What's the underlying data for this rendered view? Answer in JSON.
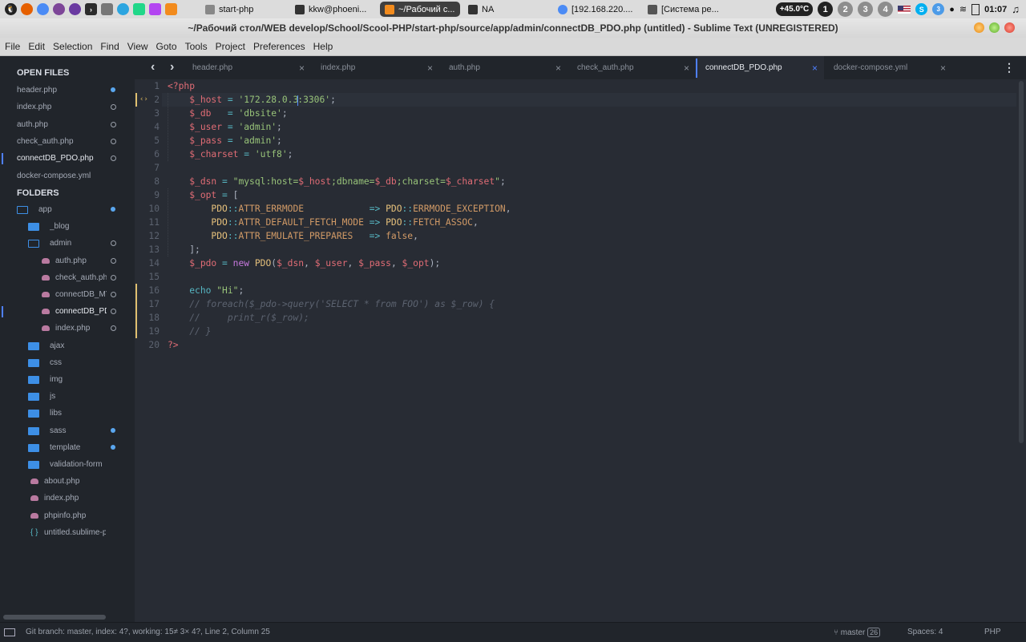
{
  "system_panel": {
    "taskbar": [
      {
        "label": "start-php",
        "active": false
      },
      {
        "label": "kkw@phoeni...",
        "active": false
      },
      {
        "label": "~/Рабочий с...",
        "active": true
      },
      {
        "label": "NA",
        "active": false
      },
      {
        "label": "[192.168.220....",
        "active": false
      },
      {
        "label": "[Система ре...",
        "active": false
      }
    ],
    "temperature": "+45.0°C",
    "workspaces": [
      "1",
      "2",
      "3",
      "4"
    ],
    "current_workspace": "1",
    "tray_badge": "3",
    "clock": "01:07"
  },
  "window": {
    "title": "~/Рабочий стол/WEB develop/School/Scool-PHP/start-php/source/app/admin/connectDB_PDO.php (untitled) - Sublime Text (UNREGISTERED)"
  },
  "menu": [
    "File",
    "Edit",
    "Selection",
    "Find",
    "View",
    "Goto",
    "Tools",
    "Project",
    "Preferences",
    "Help"
  ],
  "sidebar": {
    "open_files_header": "OPEN FILES",
    "open_files": [
      {
        "name": "header.php",
        "state": "modified",
        "active": false
      },
      {
        "name": "index.php",
        "state": "saved",
        "active": false
      },
      {
        "name": "auth.php",
        "state": "saved",
        "active": false
      },
      {
        "name": "check_auth.php",
        "state": "saved",
        "active": false
      },
      {
        "name": "connectDB_PDO.php",
        "state": "saved",
        "active": true
      },
      {
        "name": "docker-compose.yml",
        "state": "none",
        "active": false
      }
    ],
    "folders_header": "FOLDERS",
    "tree": [
      {
        "name": "app",
        "kind": "folder-open",
        "level": 0,
        "state": "modified"
      },
      {
        "name": "_blog",
        "kind": "folder",
        "level": 1,
        "state": "none"
      },
      {
        "name": "admin",
        "kind": "folder-open",
        "level": 1,
        "state": "saved"
      },
      {
        "name": "auth.php",
        "kind": "php",
        "level": 2,
        "state": "saved"
      },
      {
        "name": "check_auth.php",
        "kind": "php",
        "level": 2,
        "state": "saved"
      },
      {
        "name": "connectDB_MYSQLI.php",
        "kind": "php",
        "level": 2,
        "state": "saved"
      },
      {
        "name": "connectDB_PDO.php",
        "kind": "php",
        "level": 2,
        "state": "saved",
        "active": true
      },
      {
        "name": "index.php",
        "kind": "php",
        "level": 2,
        "state": "saved"
      },
      {
        "name": "ajax",
        "kind": "folder",
        "level": 1,
        "state": "none"
      },
      {
        "name": "css",
        "kind": "folder",
        "level": 1,
        "state": "none"
      },
      {
        "name": "img",
        "kind": "folder",
        "level": 1,
        "state": "none"
      },
      {
        "name": "js",
        "kind": "folder",
        "level": 1,
        "state": "none"
      },
      {
        "name": "libs",
        "kind": "folder",
        "level": 1,
        "state": "none"
      },
      {
        "name": "sass",
        "kind": "folder",
        "level": 1,
        "state": "modified"
      },
      {
        "name": "template",
        "kind": "folder",
        "level": 1,
        "state": "modified"
      },
      {
        "name": "validation-form",
        "kind": "folder",
        "level": 1,
        "state": "none"
      },
      {
        "name": "about.php",
        "kind": "php",
        "level": 0,
        "state": "none"
      },
      {
        "name": "index.php",
        "kind": "php",
        "level": 0,
        "state": "none"
      },
      {
        "name": "phpinfo.php",
        "kind": "php",
        "level": 0,
        "state": "none"
      },
      {
        "name": "untitled.sublime-project",
        "kind": "json",
        "level": 0,
        "state": "none"
      }
    ]
  },
  "tabs": [
    {
      "name": "header.php",
      "active": false
    },
    {
      "name": "index.php",
      "active": false
    },
    {
      "name": "auth.php",
      "active": false
    },
    {
      "name": "check_auth.php",
      "active": false
    },
    {
      "name": "connectDB_PDO.php",
      "active": true
    },
    {
      "name": "docker-compose.yml",
      "active": false
    }
  ],
  "editor": {
    "current_line": 2,
    "modified_lines": [
      2,
      16,
      17,
      18,
      19
    ],
    "lines": [
      [
        [
          "t-tag",
          "<?php"
        ]
      ],
      [
        [
          "",
          "    "
        ],
        [
          "t-var",
          "$_host"
        ],
        [
          "t-op",
          " = "
        ],
        [
          "t-str",
          "'172.28.0.3"
        ],
        [
          "caret",
          ""
        ],
        [
          "t-str",
          ":3306'"
        ],
        [
          "",
          ";"
        ]
      ],
      [
        [
          "",
          "    "
        ],
        [
          "t-var",
          "$_db"
        ],
        [
          "t-op",
          "   = "
        ],
        [
          "t-str",
          "'dbsite'"
        ],
        [
          "",
          ";"
        ]
      ],
      [
        [
          "",
          "    "
        ],
        [
          "t-var",
          "$_user"
        ],
        [
          "t-op",
          " = "
        ],
        [
          "t-str",
          "'admin'"
        ],
        [
          "",
          ";"
        ]
      ],
      [
        [
          "",
          "    "
        ],
        [
          "t-var",
          "$_pass"
        ],
        [
          "t-op",
          " = "
        ],
        [
          "t-str",
          "'admin'"
        ],
        [
          "",
          ";"
        ]
      ],
      [
        [
          "",
          "    "
        ],
        [
          "t-var",
          "$_charset"
        ],
        [
          "t-op",
          " = "
        ],
        [
          "t-str",
          "'utf8'"
        ],
        [
          "",
          ";"
        ]
      ],
      [],
      [
        [
          "",
          "    "
        ],
        [
          "t-var",
          "$_dsn"
        ],
        [
          "t-op",
          " = "
        ],
        [
          "t-str",
          "\"mysql:host="
        ],
        [
          "t-var",
          "$_host"
        ],
        [
          "t-str",
          ";dbname="
        ],
        [
          "t-var",
          "$_db"
        ],
        [
          "t-str",
          ";charset="
        ],
        [
          "t-var",
          "$_charset"
        ],
        [
          "t-str",
          "\""
        ],
        [
          "",
          ";"
        ]
      ],
      [
        [
          "",
          "    "
        ],
        [
          "t-var",
          "$_opt"
        ],
        [
          "t-op",
          " = "
        ],
        [
          "",
          "["
        ]
      ],
      [
        [
          "",
          "        "
        ],
        [
          "t-cls",
          "PDO"
        ],
        [
          "t-op",
          "::"
        ],
        [
          "t-const",
          "ATTR_ERRMODE"
        ],
        [
          "",
          "            "
        ],
        [
          "t-op",
          "=> "
        ],
        [
          "t-cls",
          "PDO"
        ],
        [
          "t-op",
          "::"
        ],
        [
          "t-const",
          "ERRMODE_EXCEPTION"
        ],
        [
          "",
          ","
        ]
      ],
      [
        [
          "",
          "        "
        ],
        [
          "t-cls",
          "PDO"
        ],
        [
          "t-op",
          "::"
        ],
        [
          "t-const",
          "ATTR_DEFAULT_FETCH_MODE"
        ],
        [
          "",
          " "
        ],
        [
          "t-op",
          "=> "
        ],
        [
          "t-cls",
          "PDO"
        ],
        [
          "t-op",
          "::"
        ],
        [
          "t-const",
          "FETCH_ASSOC"
        ],
        [
          "",
          ","
        ]
      ],
      [
        [
          "",
          "        "
        ],
        [
          "t-cls",
          "PDO"
        ],
        [
          "t-op",
          "::"
        ],
        [
          "t-const",
          "ATTR_EMULATE_PREPARES"
        ],
        [
          "",
          "   "
        ],
        [
          "t-op",
          "=> "
        ],
        [
          "t-const",
          "false"
        ],
        [
          "",
          ","
        ]
      ],
      [
        [
          "",
          "    "
        ],
        [
          "",
          "];"
        ]
      ],
      [
        [
          "",
          "    "
        ],
        [
          "t-var",
          "$_pdo"
        ],
        [
          "t-op",
          " = "
        ],
        [
          "t-kw",
          "new "
        ],
        [
          "t-cls",
          "PDO"
        ],
        [
          "",
          "("
        ],
        [
          "t-var",
          "$_dsn"
        ],
        [
          "",
          ", "
        ],
        [
          "t-var",
          "$_user"
        ],
        [
          "",
          ", "
        ],
        [
          "t-var",
          "$_pass"
        ],
        [
          "",
          ", "
        ],
        [
          "t-var",
          "$_opt"
        ],
        [
          "",
          ");"
        ]
      ],
      [],
      [
        [
          "",
          "    "
        ],
        [
          "t-fn",
          "echo "
        ],
        [
          "t-str",
          "\"Hi\""
        ],
        [
          "",
          ";"
        ]
      ],
      [
        [
          "",
          "    "
        ],
        [
          "t-cmt",
          "// foreach($_pdo->query('SELECT * from FOO') as $_row) {"
        ]
      ],
      [
        [
          "",
          "    "
        ],
        [
          "t-cmt",
          "//     print_r($_row);"
        ]
      ],
      [
        [
          "",
          "    "
        ],
        [
          "t-cmt",
          "// }"
        ]
      ],
      [
        [
          "t-tag",
          "?>"
        ]
      ]
    ]
  },
  "status": {
    "left": "Git branch: master, index: 4?, working: 15≠ 3× 4?, Line 2, Column 25",
    "branch": "master",
    "branch_count": "26",
    "spaces": "Spaces: 4",
    "syntax": "PHP"
  },
  "colors": {
    "editor_bg": "#282c34",
    "sidebar_bg": "#21252b",
    "accent": "#4f80ff",
    "modified_dot": "#5aa7ef"
  }
}
